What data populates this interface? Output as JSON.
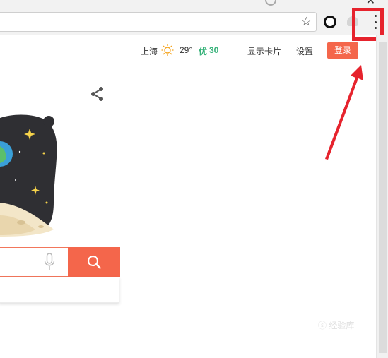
{
  "browser": {
    "close_symbol": "✕",
    "star_symbol": "☆",
    "icons": [
      "close-icon",
      "star-icon",
      "extension-o-icon",
      "extension-icon",
      "more-vert-icon"
    ]
  },
  "nav": {
    "city": "上海",
    "temperature": "29°",
    "aqi_label": "优",
    "aqi_value": "30",
    "cards_label": "显示卡片",
    "settings_label": "设置",
    "login_label": "登录"
  },
  "colors": {
    "accent": "#f4664b",
    "aqi": "#38b27a",
    "highlight": "#e6232d"
  },
  "icons": [
    "sun-icon",
    "share-icon",
    "microphone-icon",
    "search-icon"
  ],
  "watermark": "ⓢ 经验库"
}
